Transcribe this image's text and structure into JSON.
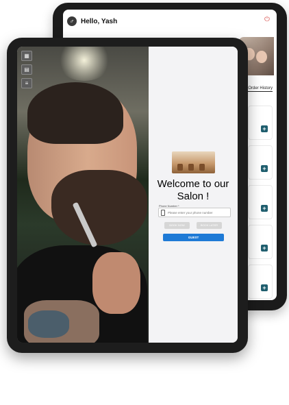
{
  "back_app": {
    "greeting": "Hello, Yash",
    "order_history": "Order History",
    "add_buttons": [
      "+",
      "+",
      "+",
      "+",
      "+"
    ]
  },
  "front_app": {
    "welcome_title": "Welcome to our Salon !",
    "phone_label": "Phone Number *",
    "phone_placeholder": "Please enter your phone number",
    "book_now": "BOOK NOW",
    "book_later": "BOOK LATER",
    "guest": "GUEST"
  },
  "icons": [
    "user-icon",
    "power-icon",
    "grid-icon",
    "calendar-icon",
    "menu-icon",
    "phone-icon",
    "plus-icon"
  ],
  "colors": {
    "accent_blue": "#1e7ad6",
    "add_button_teal": "#1f5e6e",
    "power_red": "#d9534f"
  }
}
